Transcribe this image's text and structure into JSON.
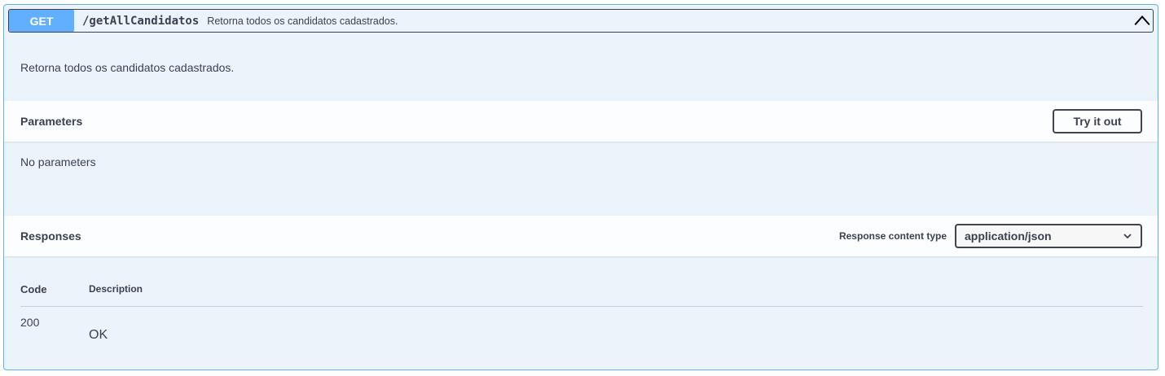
{
  "operation": {
    "method": "GET",
    "path": "/getAllCandidatos",
    "summary": "Retorna todos os candidatos cadastrados.",
    "description": "Retorna todos os candidatos cadastrados."
  },
  "parameters": {
    "title": "Parameters",
    "try_label": "Try it out",
    "empty_text": "No parameters"
  },
  "responses": {
    "title": "Responses",
    "content_type_label": "Response content type",
    "content_type_value": "application/json",
    "columns": [
      "Code",
      "Description"
    ],
    "rows": [
      {
        "code": "200",
        "description": "OK"
      }
    ]
  },
  "icons": {
    "collapse": "chevron-up-icon",
    "dropdown": "chevron-down-icon"
  },
  "colors": {
    "method_accent": "#61affe",
    "block_background": "#ebf3fb",
    "text": "#3b4151"
  }
}
